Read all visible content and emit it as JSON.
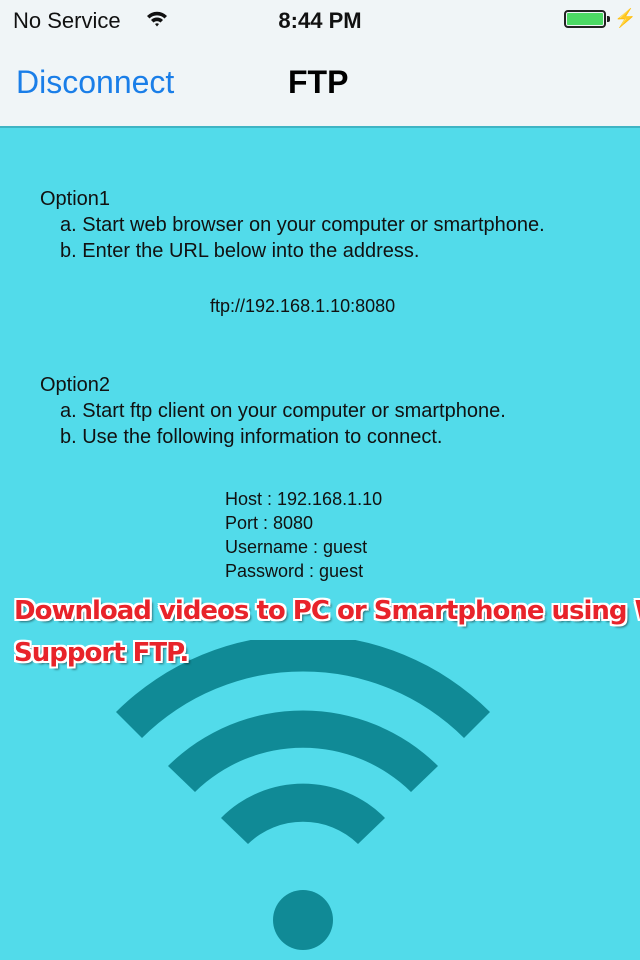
{
  "status_bar": {
    "carrier": "No Service",
    "time": "8:44 PM",
    "battery_level": 1.0,
    "charging": true
  },
  "nav": {
    "left_button": "Disconnect",
    "title": "FTP"
  },
  "option1": {
    "heading": "Option1",
    "step_a": "a. Start web browser on your computer or smartphone.",
    "step_b": "b. Enter the URL below into the address.",
    "url": "ftp://192.168.1.10:8080"
  },
  "option2": {
    "heading": "Option2",
    "step_a": "a. Start ftp client on your computer or smartphone.",
    "step_b": "b. Use the following information to connect.",
    "host": "Host : 192.168.1.10",
    "port": "Port : 8080",
    "username": "Username : guest",
    "password": "Password : guest"
  },
  "promo": {
    "line1": "Download videos to PC or Smartphone using WiFi.",
    "line2": "Support FTP."
  },
  "colors": {
    "background": "#52dbea",
    "accent": "#1a7ee8",
    "wifi_icon": "#108a96",
    "promo_text": "#e8232a"
  }
}
